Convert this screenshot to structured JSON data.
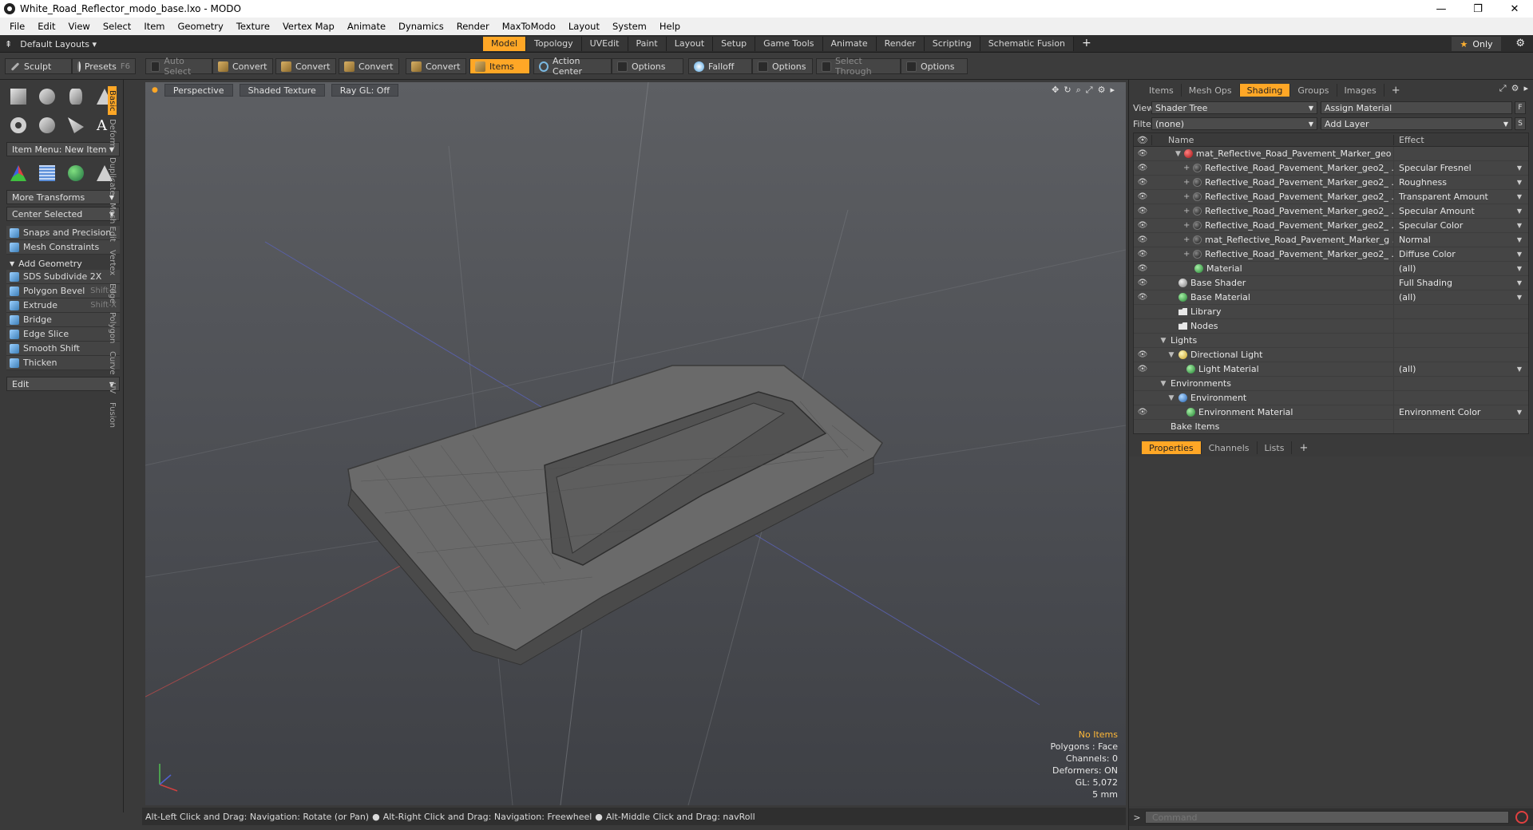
{
  "window": {
    "title": "White_Road_Reflector_modo_base.lxo - MODO",
    "minimize": "—",
    "maximize": "❐",
    "close": "✕"
  },
  "menu": [
    "File",
    "Edit",
    "View",
    "Select",
    "Item",
    "Geometry",
    "Texture",
    "Vertex Map",
    "Animate",
    "Dynamics",
    "Render",
    "MaxToModo",
    "Layout",
    "System",
    "Help"
  ],
  "layoutbar": {
    "layout_select": "Default Layouts ▾",
    "tabs": [
      "Model",
      "Topology",
      "UVEdit",
      "Paint",
      "Layout",
      "Setup",
      "Game Tools",
      "Animate",
      "Render",
      "Scripting",
      "Schematic Fusion"
    ],
    "active_tab": "Model",
    "plus": "+",
    "only_label": "Only",
    "star": "★",
    "gear": "⚙"
  },
  "toolbar": {
    "sculpt": "Sculpt",
    "presets": "Presets",
    "presets_key": "F6",
    "auto_select": "Auto Select",
    "convert1": "Convert",
    "convert2": "Convert",
    "convert3": "Convert",
    "convert4": "Convert",
    "items": "Items",
    "action_center": "Action Center",
    "options1": "Options",
    "falloff": "Falloff",
    "options2": "Options",
    "select_through": "Select Through",
    "options3": "Options"
  },
  "leftpanel": {
    "item_menu": "Item Menu: New Item",
    "more_transforms": "More Transforms",
    "center_selected": "Center Selected",
    "snaps": "Snaps and Precision",
    "mesh_constraints": "Mesh Constraints",
    "add_geometry": "Add Geometry",
    "tools": [
      {
        "label": "SDS Subdivide 2X",
        "key": ""
      },
      {
        "label": "Polygon Bevel",
        "key": "Shift-B"
      },
      {
        "label": "Extrude",
        "key": "Shift-X"
      },
      {
        "label": "Bridge",
        "key": ""
      },
      {
        "label": "Edge Slice",
        "key": ""
      },
      {
        "label": "Smooth Shift",
        "key": ""
      },
      {
        "label": "Thicken",
        "key": ""
      }
    ],
    "edit": "Edit",
    "vtabs": [
      "Basic",
      "Deform",
      "Duplicate",
      "Mesh Edit",
      "Vertex",
      "Edge",
      "Polygon",
      "Curve",
      "UV",
      "Fusion"
    ]
  },
  "viewport": {
    "view": "Perspective",
    "shading": "Shaded Texture",
    "raygl": "Ray GL: Off",
    "info": {
      "no_items": "No Items",
      "polygons": "Polygons : Face",
      "channels": "Channels: 0",
      "deformers": "Deformers: ON",
      "gl": "GL: 5,072",
      "scale": "5 mm"
    }
  },
  "status": {
    "hint1": "Alt-Left Click and Drag: Navigation: Rotate (or Pan)",
    "hint2": "Alt-Right Click and Drag: Navigation: Freewheel",
    "hint3": "Alt-Middle Click and Drag: navRoll"
  },
  "rightpanel": {
    "tabs": [
      "Items",
      "Mesh Ops",
      "Shading",
      "Groups",
      "Images"
    ],
    "active_tab": "Shading",
    "view_label": "View",
    "view_value": "Shader Tree",
    "assign_material": "Assign Material",
    "filter_label": "Filter",
    "filter_value": "(none)",
    "add_layer": "Add Layer",
    "f_btn": "F",
    "s_btn": "S",
    "col_name": "Name",
    "col_effect": "Effect",
    "rows": [
      {
        "name": "mat_Reflective_Road_Pavement_Marker_geo ...",
        "effect": "",
        "icon": "red",
        "indent": 3,
        "twist": "▼",
        "eye": true
      },
      {
        "name": "Reflective_Road_Pavement_Marker_geo2_ ...",
        "effect": "Specular Fresnel",
        "icon": "dark",
        "indent": 4,
        "twist": "+",
        "eye": true
      },
      {
        "name": "Reflective_Road_Pavement_Marker_geo2_ ...",
        "effect": "Roughness",
        "icon": "dark",
        "indent": 4,
        "twist": "+",
        "eye": true
      },
      {
        "name": "Reflective_Road_Pavement_Marker_geo2_ ...",
        "effect": "Transparent Amount",
        "icon": "dark",
        "indent": 4,
        "twist": "+",
        "eye": true
      },
      {
        "name": "Reflective_Road_Pavement_Marker_geo2_ ...",
        "effect": "Specular Amount",
        "icon": "dark",
        "indent": 4,
        "twist": "+",
        "eye": true
      },
      {
        "name": "Reflective_Road_Pavement_Marker_geo2_ ...",
        "effect": "Specular Color",
        "icon": "dark",
        "indent": 4,
        "twist": "+",
        "eye": true
      },
      {
        "name": "mat_Reflective_Road_Pavement_Marker_g ...",
        "effect": "Normal",
        "icon": "dark",
        "indent": 4,
        "twist": "+",
        "eye": true
      },
      {
        "name": "Reflective_Road_Pavement_Marker_geo2_ ...",
        "effect": "Diffuse Color",
        "icon": "dark",
        "indent": 4,
        "twist": "+",
        "eye": true
      },
      {
        "name": "Material",
        "effect": "(all)",
        "icon": "green",
        "indent": 4,
        "twist": "",
        "eye": true
      },
      {
        "name": "Base Shader",
        "effect": "Full Shading",
        "icon": "grey",
        "indent": 2,
        "twist": "",
        "eye": true
      },
      {
        "name": "Base Material",
        "effect": "(all)",
        "icon": "green",
        "indent": 2,
        "twist": "",
        "eye": true
      },
      {
        "name": "Library",
        "effect": "",
        "icon": "folder",
        "indent": 2,
        "twist": "",
        "eye": false
      },
      {
        "name": "Nodes",
        "effect": "",
        "icon": "folder",
        "indent": 2,
        "twist": "",
        "eye": false
      },
      {
        "name": "Lights",
        "effect": "",
        "icon": "",
        "indent": 1,
        "twist": "▼",
        "eye": false
      },
      {
        "name": "Directional Light",
        "effect": "",
        "icon": "light",
        "indent": 2,
        "twist": "▼",
        "eye": true
      },
      {
        "name": "Light Material",
        "effect": "(all)",
        "icon": "green",
        "indent": 3,
        "twist": "",
        "eye": true
      },
      {
        "name": "Environments",
        "effect": "",
        "icon": "",
        "indent": 1,
        "twist": "▼",
        "eye": false
      },
      {
        "name": "Environment",
        "effect": "",
        "icon": "blue",
        "indent": 2,
        "twist": "▼",
        "eye": false
      },
      {
        "name": "Environment Material",
        "effect": "Environment Color",
        "icon": "green",
        "indent": 3,
        "twist": "",
        "eye": true
      },
      {
        "name": "Bake Items",
        "effect": "",
        "icon": "",
        "indent": 1,
        "twist": "",
        "eye": false
      }
    ],
    "props_tabs": [
      "Properties",
      "Channels",
      "Lists"
    ],
    "props_active": "Properties",
    "command_placeholder": "Command"
  }
}
